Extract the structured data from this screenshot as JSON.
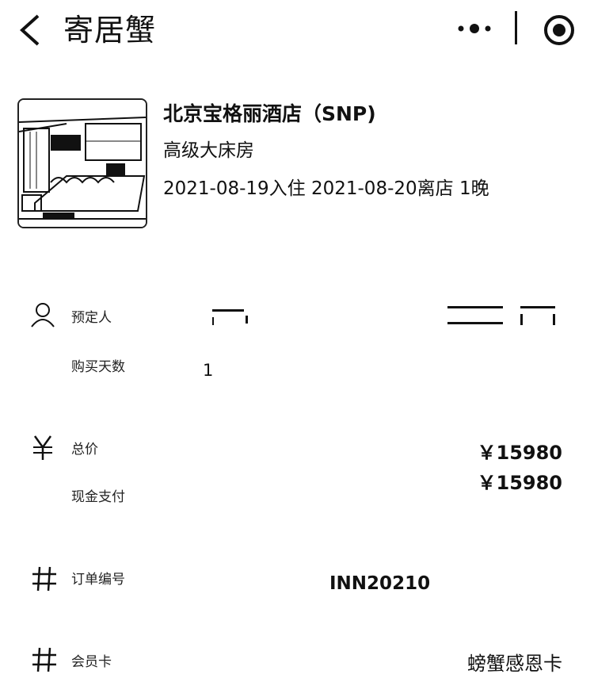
{
  "nav": {
    "title": "寄居蟹"
  },
  "hotel": {
    "name": "北京宝格丽酒店（SNP)",
    "room_type": "高级大床房",
    "stay": "2021-08-19入住 2021-08-20离店 1晚"
  },
  "booking": {
    "booker_label": "预定人",
    "days_label": "购买天数",
    "days_value": "1",
    "total_label": "总价",
    "total_value": "￥15980",
    "cash_label": "现金支付",
    "cash_value": "￥15980",
    "order_label": "订单编号",
    "order_value": "INN20210",
    "member_label": "会员卡",
    "member_value": "螃蟹感恩卡"
  },
  "icons": {
    "back": "back-arrow-icon",
    "more": "more-dots-icon",
    "close": "mini-program-close-icon",
    "person": "person-icon",
    "yen": "yen-icon",
    "hash": "hash-icon"
  }
}
